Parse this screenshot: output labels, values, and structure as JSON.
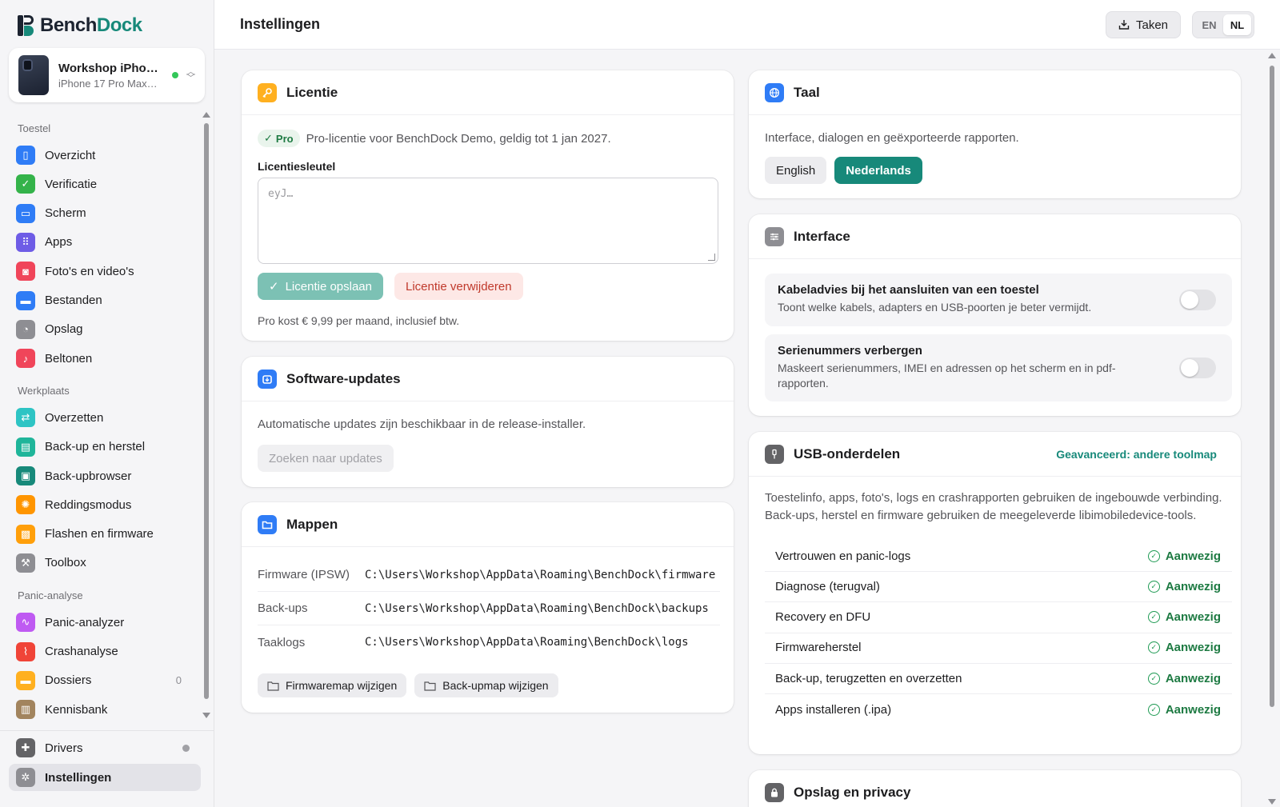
{
  "app": {
    "logo_part1": "Bench",
    "logo_part2": "Dock"
  },
  "device": {
    "name": "Workshop iPho…",
    "model": "iPhone 17 Pro Max…",
    "status_color": "#34c759"
  },
  "sidebar": {
    "sections": [
      {
        "label": "Toestel",
        "items": [
          {
            "label": "Overzicht",
            "icon": "phone-icon",
            "color": "#2f7cf6"
          },
          {
            "label": "Verificatie",
            "icon": "shield-icon",
            "color": "#34b34a"
          },
          {
            "label": "Scherm",
            "icon": "screen-icon",
            "color": "#2f7cf6"
          },
          {
            "label": "Apps",
            "icon": "grid-icon",
            "color": "#6e5ce6"
          },
          {
            "label": "Foto's en video's",
            "icon": "photo-icon",
            "color": "#f0455a"
          },
          {
            "label": "Bestanden",
            "icon": "folder-icon",
            "color": "#2f7cf6"
          },
          {
            "label": "Opslag",
            "icon": "pie-icon",
            "color": "#8e8e93"
          },
          {
            "label": "Beltonen",
            "icon": "music-icon",
            "color": "#f0455a"
          }
        ]
      },
      {
        "label": "Werkplaats",
        "items": [
          {
            "label": "Overzetten",
            "icon": "transfer-icon",
            "color": "#2ec4c4"
          },
          {
            "label": "Back-up en herstel",
            "icon": "archive-icon",
            "color": "#1fb59a"
          },
          {
            "label": "Back-upbrowser",
            "icon": "browser-icon",
            "color": "#17897a"
          },
          {
            "label": "Reddingsmodus",
            "icon": "lifebuoy-icon",
            "color": "#ff9500"
          },
          {
            "label": "Flashen en firmware",
            "icon": "chip-icon",
            "color": "#ff9f0a"
          },
          {
            "label": "Toolbox",
            "icon": "wrench-icon",
            "color": "#8e8e93"
          }
        ]
      },
      {
        "label": "Panic-analyse",
        "items": [
          {
            "label": "Panic-analyzer",
            "icon": "pulse-icon",
            "color": "#bf5af2"
          },
          {
            "label": "Crashanalyse",
            "icon": "chart-icon",
            "color": "#f04438"
          },
          {
            "label": "Dossiers",
            "icon": "folder-icon",
            "color": "#ffb020",
            "count": "0"
          },
          {
            "label": "Kennisbank",
            "icon": "book-icon",
            "color": "#a2845e"
          }
        ]
      }
    ],
    "bottom": [
      {
        "label": "Drivers",
        "icon": "puzzle-icon",
        "color": "#636366"
      },
      {
        "label": "Instellingen",
        "icon": "gear-icon",
        "color": "#8e8e93"
      }
    ]
  },
  "header": {
    "title": "Instellingen",
    "tasks_label": "Taken",
    "lang_en": "EN",
    "lang_nl": "NL"
  },
  "license": {
    "title": "Licentie",
    "badge": "Pro",
    "status": "Pro-licentie voor BenchDock Demo, geldig tot 1 jan 2027.",
    "key_label": "Licentiesleutel",
    "key_placeholder": "eyJ…",
    "save_label": "Licentie opslaan",
    "remove_label": "Licentie verwijderen",
    "price_note": "Pro kost € 9,99 per maand, inclusief btw."
  },
  "updates": {
    "title": "Software-updates",
    "text": "Automatische updates zijn beschikbaar in de release-installer.",
    "button": "Zoeken naar updates"
  },
  "folders": {
    "title": "Mappen",
    "rows": [
      {
        "key": "Firmware (IPSW)",
        "value": "C:\\Users\\Workshop\\AppData\\Roaming\\BenchDock\\firmware"
      },
      {
        "key": "Back-ups",
        "value": "C:\\Users\\Workshop\\AppData\\Roaming\\BenchDock\\backups"
      },
      {
        "key": "Taaklogs",
        "value": "C:\\Users\\Workshop\\AppData\\Roaming\\BenchDock\\logs"
      }
    ],
    "change_firmware": "Firmwaremap wijzigen",
    "change_backup": "Back-upmap wijzigen"
  },
  "language": {
    "title": "Taal",
    "text": "Interface, dialogen en geëxporteerde rapporten.",
    "english": "English",
    "dutch": "Nederlands"
  },
  "interface": {
    "title": "Interface",
    "toggles": [
      {
        "title": "Kabeladvies bij het aansluiten van een toestel",
        "desc": "Toont welke kabels, adapters en USB-poorten je beter vermijdt.",
        "on": false
      },
      {
        "title": "Serienummers verbergen",
        "desc": "Maskeert serienummers, IMEI en adressen op het scherm en in pdf-rapporten.",
        "on": false
      }
    ]
  },
  "usb": {
    "title": "USB-onderdelen",
    "advanced": "Geavanceerd: andere toolmap",
    "text": "Toestelinfo, apps, foto's, logs en crashrapporten gebruiken de ingebouwde verbinding. Back-ups, herstel en firmware gebruiken de meegeleverde libimobiledevice-tools.",
    "rows": [
      {
        "name": "Vertrouwen en panic-logs",
        "status": "Aanwezig"
      },
      {
        "name": "Diagnose (terugval)",
        "status": "Aanwezig"
      },
      {
        "name": "Recovery en DFU",
        "status": "Aanwezig"
      },
      {
        "name": "Firmwareherstel",
        "status": "Aanwezig"
      },
      {
        "name": "Back-up, terugzetten en overzetten",
        "status": "Aanwezig"
      },
      {
        "name": "Apps installeren (.ipa)",
        "status": "Aanwezig"
      }
    ]
  },
  "storage": {
    "title": "Opslag en privacy"
  },
  "colors": {
    "accent": "#17897a",
    "ok": "#1d7a42",
    "danger": "#c0392b"
  }
}
